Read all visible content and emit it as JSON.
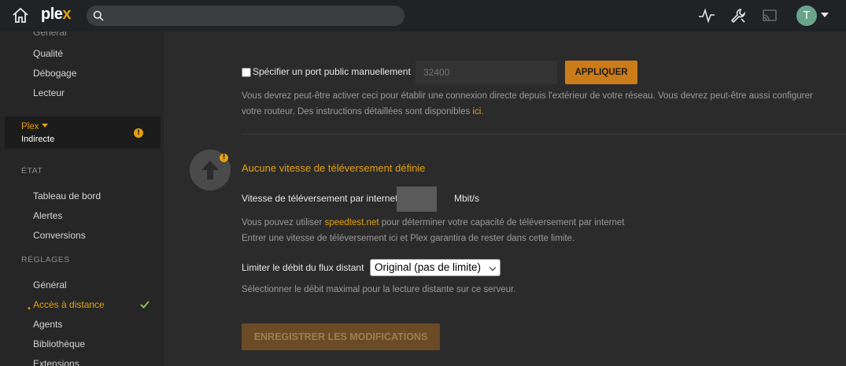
{
  "topbar": {
    "logo_text": "plex",
    "logo_accent": "#e5a00d",
    "search_placeholder": "",
    "avatar_initial": "T",
    "icons": [
      "home-icon",
      "search-icon",
      "activity-icon",
      "settings-wrench-icon",
      "cast-icon",
      "chevron-down-icon"
    ]
  },
  "sidebar": {
    "partial_top": "Général",
    "top_items": [
      "Qualité",
      "Débogage",
      "Lecteur"
    ],
    "server": {
      "name": "Plex",
      "status": "Indirecte",
      "warning": "!"
    },
    "section_state": "ÉTAT",
    "state_items": [
      "Tableau de bord",
      "Alertes",
      "Conversions"
    ],
    "section_settings": "RÉGLAGES",
    "settings_items": [
      "Général",
      "Accès à distance",
      "Agents",
      "Bibliothèque",
      "Extensions"
    ],
    "active_item": "Accès à distance",
    "active_color": "#e5a00d",
    "check_color": "#8bc34a"
  },
  "main": {
    "port_checkbox_label": "Spécifier un port public manuellement",
    "port_placeholder": "32400",
    "apply_button": "APPLIQUER",
    "port_help_1": "Vous devrez peut-être activer ceci pour établir une connexion directe depuis l'extérieur de votre réseau. Vous devrez peut-être aussi configurer",
    "port_help_2_a": "votre routeur. Des instructions détaillées sont disponibles ",
    "port_help_2_link": "ici",
    "port_help_2_b": ".",
    "upload_warning": "!",
    "upload_title": "Aucune vitesse de téléversement définie",
    "upload_speed_label": "Vitesse de téléversement par internet",
    "upload_speed_unit": "Mbit/s",
    "upload_help_1_a": "Vous pouvez utiliser ",
    "upload_help_1_link": "speedtest.net",
    "upload_help_1_b": " pour déterminer votre capacité de téléversement par internet",
    "upload_help_2": "Entrer une vitesse de téléversement ici et Plex garantira de rester dans cette limite.",
    "limit_label": "Limiter le débit du flux distant",
    "limit_selected": "Original (pas de limite)",
    "limit_help": "Sélectionner le débit maximal pour la lecture distante sur ce serveur.",
    "save_button": "ENREGISTRER LES MODIFICATIONS"
  }
}
